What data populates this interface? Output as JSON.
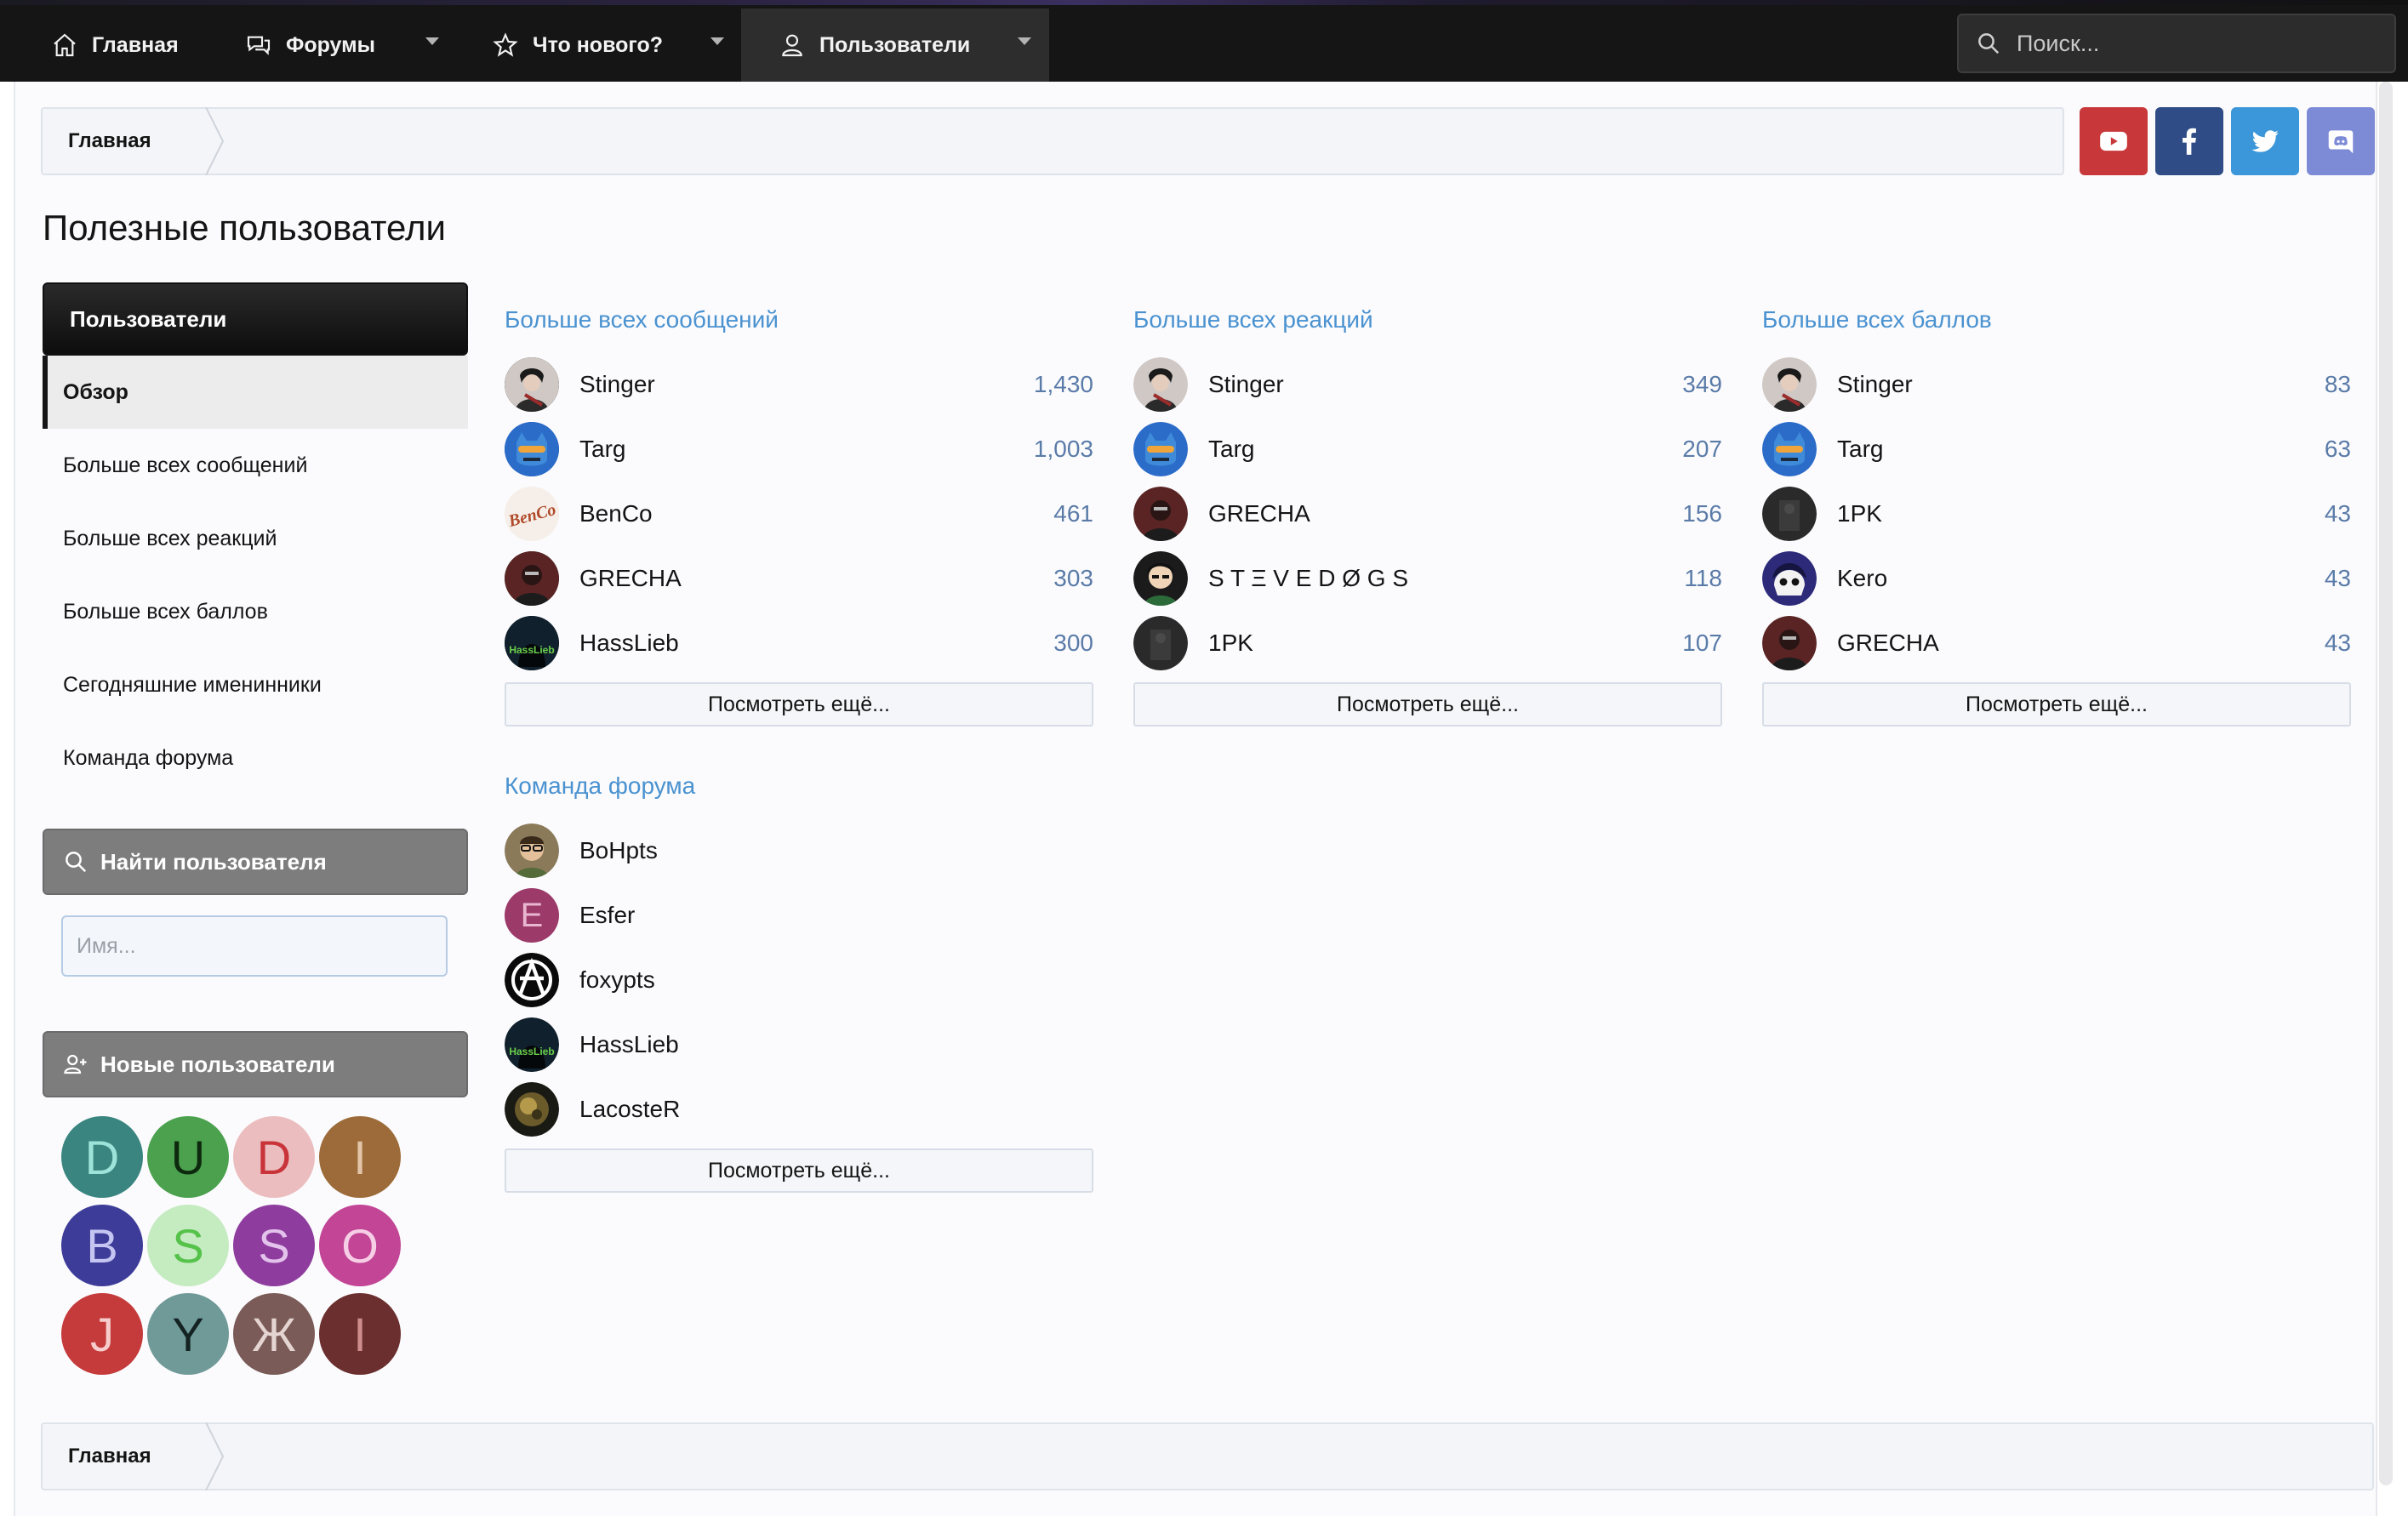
{
  "nav": {
    "home": "Главная",
    "forums": "Форумы",
    "whats_new": "Что нового?",
    "users": "Пользователи",
    "search_placeholder": "Поиск..."
  },
  "breadcrumb": {
    "home": "Главная"
  },
  "footer_breadcrumb": {
    "home": "Главная"
  },
  "social": [
    "youtube-icon",
    "facebook-icon",
    "twitter-icon",
    "discord-icon"
  ],
  "colors": {
    "youtube": "#c8383a",
    "facebook": "#2f4c86",
    "twitter": "#3b97d9",
    "discord": "#7d8ad6",
    "link": "#4a92d0",
    "stat": "#5a7ba8"
  },
  "page_title": "Полезные пользователи",
  "sidebar": {
    "header": "Пользователи",
    "items": [
      "Обзор",
      "Больше всех сообщений",
      "Больше всех реакций",
      "Больше всех баллов",
      "Сегодняшние именинники",
      "Команда форума"
    ],
    "find_user": "Найти пользователя",
    "name_placeholder": "Имя...",
    "new_users": "Новые пользователи",
    "new_user_letters": [
      "D",
      "U",
      "D",
      "I",
      "B",
      "S",
      "S",
      "O",
      "J",
      "Y",
      "Ж",
      "I"
    ]
  },
  "columns": [
    {
      "title": "Больше всех сообщений",
      "rows": [
        {
          "name": "Stinger",
          "value": "1,430"
        },
        {
          "name": "Targ",
          "value": "1,003"
        },
        {
          "name": "BenCo",
          "value": "461"
        },
        {
          "name": "GRECHA",
          "value": "303"
        },
        {
          "name": "HassLieb",
          "value": "300"
        }
      ],
      "more": "Посмотреть ещё..."
    },
    {
      "title": "Больше всех реакций",
      "rows": [
        {
          "name": "Stinger",
          "value": "349"
        },
        {
          "name": "Targ",
          "value": "207"
        },
        {
          "name": "GRECHA",
          "value": "156"
        },
        {
          "name": "S T Ξ V E D Ø G S",
          "value": "118"
        },
        {
          "name": "1PK",
          "value": "107"
        }
      ],
      "more": "Посмотреть ещё..."
    },
    {
      "title": "Больше всех баллов",
      "rows": [
        {
          "name": "Stinger",
          "value": "83"
        },
        {
          "name": "Targ",
          "value": "63"
        },
        {
          "name": "1PK",
          "value": "43"
        },
        {
          "name": "Kero",
          "value": "43"
        },
        {
          "name": "GRECHA",
          "value": "43"
        }
      ],
      "more": "Посмотреть ещё..."
    }
  ],
  "staff": {
    "title": "Команда форума",
    "rows": [
      {
        "name": "BoHpts"
      },
      {
        "name": "Esfer",
        "letter": "E"
      },
      {
        "name": "foxypts"
      },
      {
        "name": "HassLieb"
      },
      {
        "name": "LacosteR"
      }
    ],
    "more": "Посмотреть ещё..."
  }
}
